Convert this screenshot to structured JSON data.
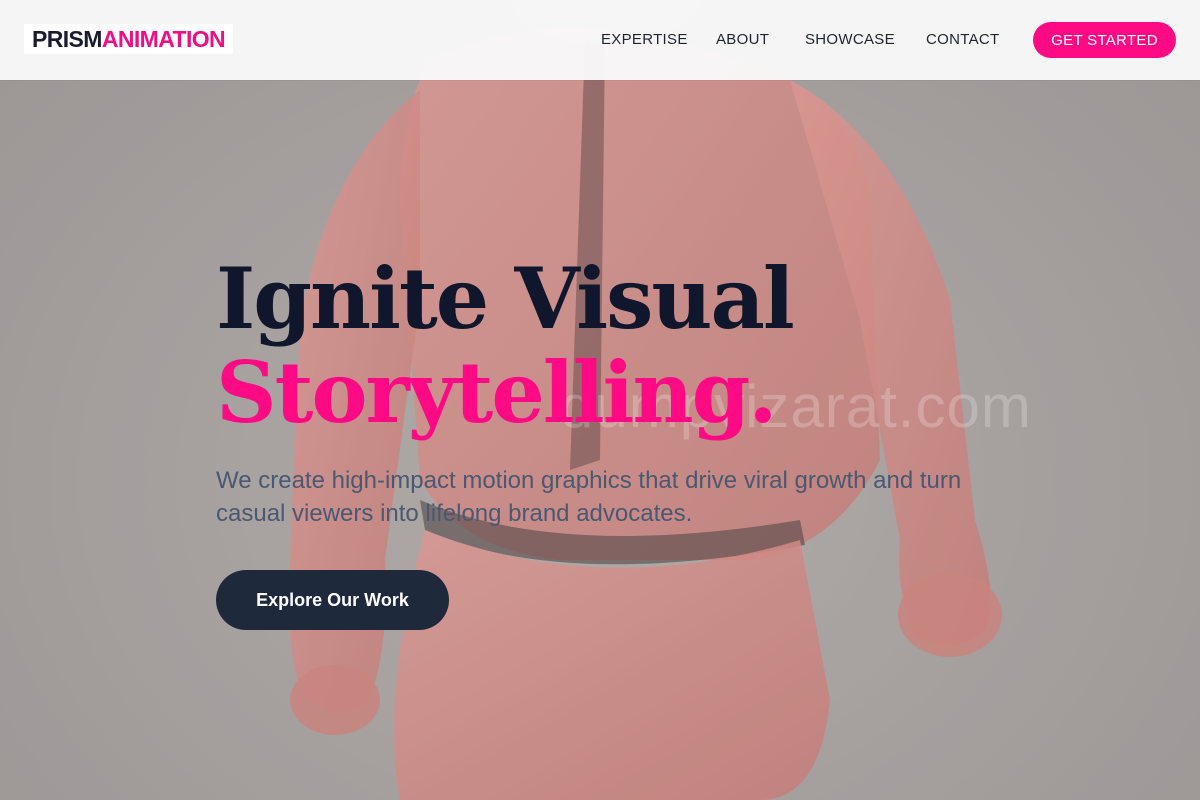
{
  "brand": {
    "name_part1": "PRISM",
    "name_part2": "ANIMATION"
  },
  "nav": {
    "items": [
      {
        "label": "EXPERTISE"
      },
      {
        "label": "ABOUT"
      },
      {
        "label": "SHOWCASE"
      },
      {
        "label": "CONTACT"
      }
    ],
    "cta_label": "GET STARTED"
  },
  "hero": {
    "headline_line1": "Ignite Visual",
    "headline_line2": "Storytelling.",
    "subtitle": "We create high-impact motion graphics that drive viral growth and turn casual viewers into lifelong brand advocates.",
    "button_label": "Explore Our Work",
    "watermark": "dumpvizarat.com"
  },
  "colors": {
    "accent": "#ff0a85",
    "navy": "#10162b",
    "button_dark": "#1e293b",
    "subtitle": "#4a5872",
    "figure": "#d9837e"
  }
}
